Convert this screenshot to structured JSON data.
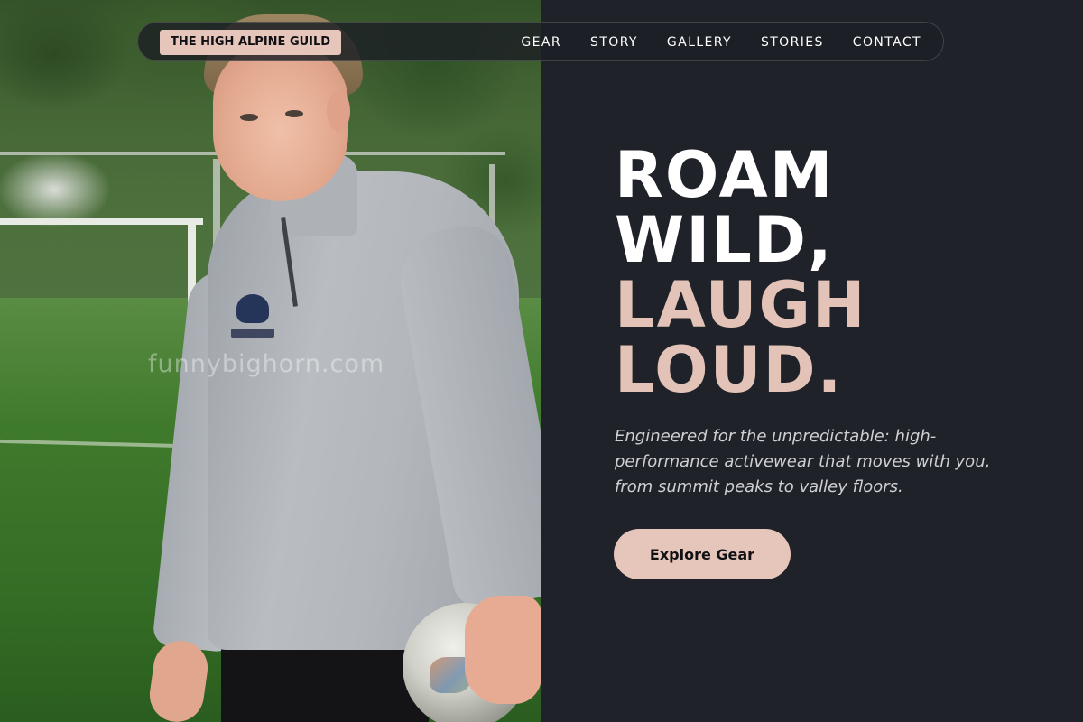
{
  "nav": {
    "brand": "THE HIGH ALPINE GUILD",
    "links": [
      "GEAR",
      "STORY",
      "GALLERY",
      "STORIES",
      "CONTACT"
    ]
  },
  "hero": {
    "headline_lines": [
      "ROAM",
      "WILD,",
      "LAUGH",
      "LOUD."
    ],
    "tagline": "Engineered for the unpredictable: high-performance activewear that moves with you, from summit peaks to valley floors.",
    "cta_label": "Explore Gear"
  },
  "photo": {
    "watermark": "funnybighorn.com"
  },
  "colors": {
    "background": "#20222a",
    "accent": "#e6c5bb",
    "headline_accent": "#e3c3b7",
    "headline_light": "#ffffff"
  }
}
